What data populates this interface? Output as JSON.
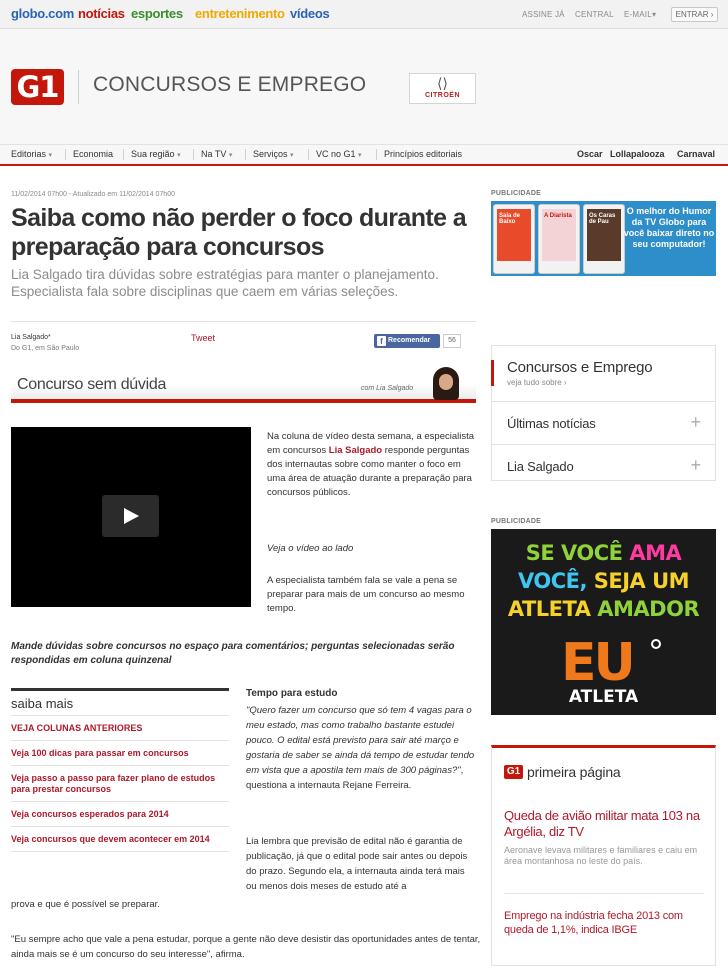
{
  "topbar": {
    "brand": "globo.com",
    "links": [
      {
        "label": "notícias",
        "color": "#c4170c"
      },
      {
        "label": "esportes",
        "color": "#3a8f2b"
      },
      {
        "label": "entretenimento",
        "color": "#f3a800"
      },
      {
        "label": "vídeos",
        "color": "#2a63b7"
      }
    ],
    "right": [
      "ASSINE JÁ",
      "CENTRAL",
      "E-MAIL"
    ],
    "email_arrow": "▾",
    "login": "ENTRAR ›"
  },
  "header": {
    "logo": "G1",
    "section": "CONCURSOS E EMPREGO",
    "sponsor_mark": "⟨⟩",
    "sponsor_name": "CITROËN"
  },
  "nav": {
    "items": [
      "Editorias",
      "Economia",
      "Sua região",
      "Na TV",
      "Serviços",
      "VC no G1",
      "Princípios editoriais"
    ],
    "chevron": "▾",
    "right_items": [
      "Oscar",
      "Lollapalooza",
      "Carnaval"
    ]
  },
  "article": {
    "date": "11/02/2014 07h00 - Atualizado em 11/02/2014 07h00",
    "headline": "Saiba como não perder o foco durante a preparação para concursos",
    "subtitle": "Lia Salgado tira dúvidas sobre estratégias para manter o planejamento. Especialista fala sobre disciplinas que caem em várias seleções.",
    "author": "Lia Salgado*",
    "location": "Do G1, em São Paulo",
    "tweet": "Tweet",
    "recommend": "Recomendar",
    "fb_letter": "f",
    "recommend_count": "56",
    "banner_title": "Concurso sem dúvida",
    "banner_by": "com Lia Salgado",
    "intro_pre": "Na coluna de vídeo desta semana, a especialista em concursos ",
    "intro_name": "Lia Salgado",
    "intro_post": " responde perguntas dos internautas sobre como manter o foco em uma área de atuação durante a preparação para concursos públicos.",
    "video_note": "Veja o vídeo ao lado",
    "p2": "A especialista também fala se vale a pena se preparar para mais de um concurso ao mesmo tempo.",
    "callout": "Mande dúvidas sobre concursos no espaço para comentários; perguntas selecionadas serão respondidas em coluna quinzenal",
    "saiba_title": "saiba mais",
    "saiba_items": [
      "VEJA COLUNAS ANTERIORES",
      "Veja 100 dicas para passar em concursos",
      "Veja passo a passo para fazer plano de estudos para prestar concursos",
      "Veja concursos esperados para 2014",
      "Veja concursos que devem acontecer em 2014"
    ],
    "tempo_title": "Tempo para estudo",
    "quote1": "\"Quero fazer um concurso que só tem 4 vagas para o meu estado, mas como trabalho bastante estudei pouco. O edital está previsto para sair até março e gostaria de saber se ainda dá tempo de estudar tendo em vista que a apostila tem mais de 300 páginas?\"",
    "quote1_after": ", questiona a internauta Rejane Ferreira.",
    "p3": "Lia lembra que previsão de edital não é garantia de publicação, já que o edital pode sair antes ou depois do prazo. Segundo ela, a internauta ainda terá mais ou menos dois meses de estudo até a",
    "p3_cont": "prova e que é possível se preparar.",
    "p4": "\"Eu sempre acho que vale a pena estudar, porque a gente não deve desistir das oportunidades antes de tentar, ainda mais se é um concurso do seu interesse\", afirma."
  },
  "sidebar": {
    "pub_label": "PUBLICIDADE",
    "ad1_phones": [
      "Saia de Baixo",
      "A Diarista",
      "Os Caras de Pau"
    ],
    "ad1_text": "O melhor do Humor da TV Globo para você baixar direto no seu computador!",
    "concursos_title": "Concursos e Emprego",
    "concursos_sub": "veja tudo sobre ›",
    "rows": [
      "Últimas notícias",
      "Lia Salgado"
    ],
    "plus": "+",
    "ad2_lines": [
      {
        "parts": [
          {
            "t": "SE VOCÊ ",
            "c": "#8fd23a"
          },
          {
            "t": "AMA",
            "c": "#ff3aa0"
          }
        ]
      },
      {
        "parts": [
          {
            "t": "VOCÊ, ",
            "c": "#3ec6f0"
          },
          {
            "t": "SEJA UM",
            "c": "#f5d12a"
          }
        ]
      },
      {
        "parts": [
          {
            "t": "ATLETA ",
            "c": "#f5d12a"
          },
          {
            "t": "AMADOR",
            "c": "#8fd23a"
          }
        ]
      }
    ],
    "ad2_eu": "EU",
    "ad2_atleta": "ATLETA",
    "primeira_logo": "G1",
    "primeira_title": "primeira página",
    "news1": "Queda de avião militar mata 103 na Argélia, diz TV",
    "news1_sub": "Aeronave levava militares e familiares e caiu em área montanhosa no leste do país.",
    "news2": "Emprego na indústria fecha 2013 com queda de 1,1%, indica IBGE"
  }
}
